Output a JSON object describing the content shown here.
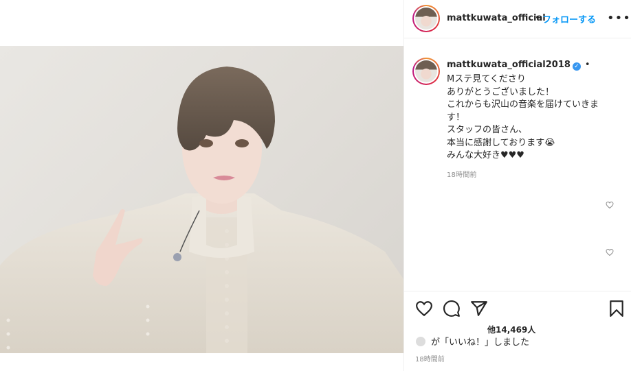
{
  "header": {
    "username": "mattkuwata_official",
    "separator": "•",
    "follow_label": "フォローする",
    "more_label": "•••"
  },
  "caption": {
    "username": "mattkuwata_official2018",
    "verified_glyph": "✓",
    "separator": "•",
    "lines": [
      "Mステ見てくださり",
      "ありがとうございました！",
      "これからも沢山の音楽を届けていきま",
      "す！",
      "スタッフの皆さん、",
      "本当に感謝しております😭",
      "みんな大好き♥♥♥"
    ],
    "time": "18時間前"
  },
  "actions": {
    "like_icon": "heart-icon",
    "comment_icon": "comment-icon",
    "share_icon": "share-icon",
    "save_icon": "bookmark-icon"
  },
  "likes": {
    "count_text": "他14,469人",
    "liked_by_text": "が「いいね！」しました"
  },
  "footer": {
    "time": "18時間前"
  }
}
